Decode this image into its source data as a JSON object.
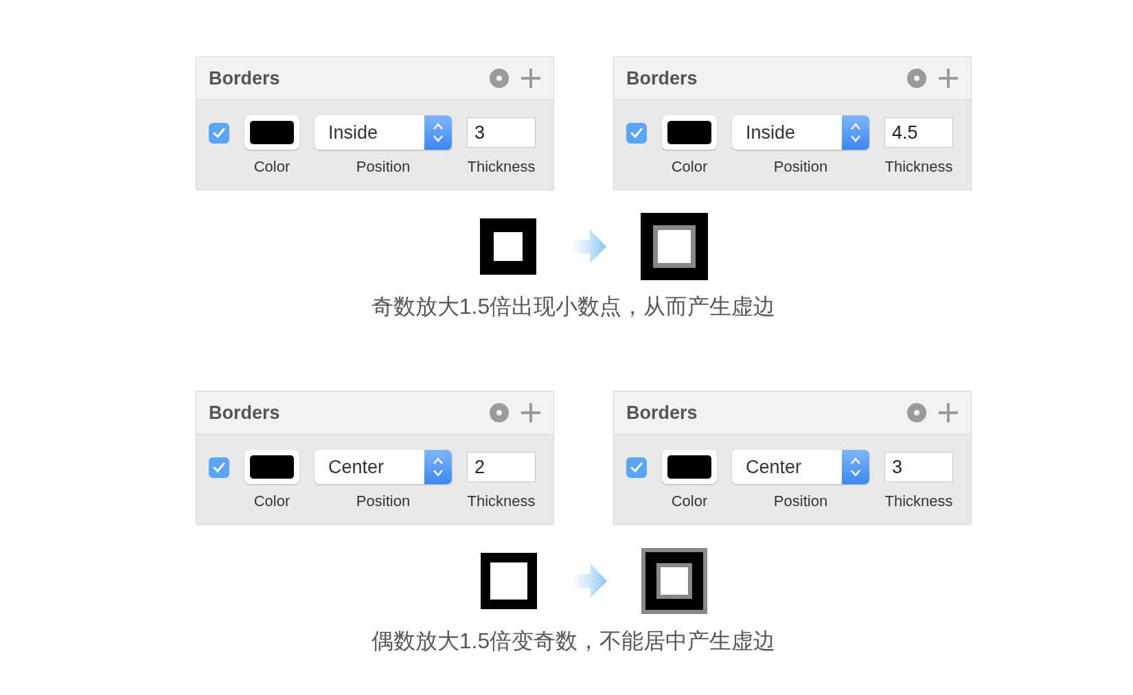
{
  "examples": [
    {
      "panels": [
        {
          "title": "Borders",
          "checked": true,
          "color_label": "Color",
          "position": "Inside",
          "position_label": "Position",
          "thickness": "3",
          "thickness_label": "Thickness"
        },
        {
          "title": "Borders",
          "checked": true,
          "color_label": "Color",
          "position": "Inside",
          "position_label": "Position",
          "thickness": "4.5",
          "thickness_label": "Thickness"
        }
      ],
      "before": {
        "kind": "sharp"
      },
      "after": {
        "kind": "blurred-inner"
      },
      "caption": "奇数放大1.5倍出现小数点，从而产生虚边"
    },
    {
      "panels": [
        {
          "title": "Borders",
          "checked": true,
          "color_label": "Color",
          "position": "Center",
          "position_label": "Position",
          "thickness": "2",
          "thickness_label": "Thickness"
        },
        {
          "title": "Borders",
          "checked": true,
          "color_label": "Color",
          "position": "Center",
          "position_label": "Position",
          "thickness": "3",
          "thickness_label": "Thickness"
        }
      ],
      "before": {
        "kind": "sharp-thin"
      },
      "after": {
        "kind": "blurred-both"
      },
      "caption": "偶数放大1.5倍变奇数，不能居中产生虚边"
    }
  ]
}
